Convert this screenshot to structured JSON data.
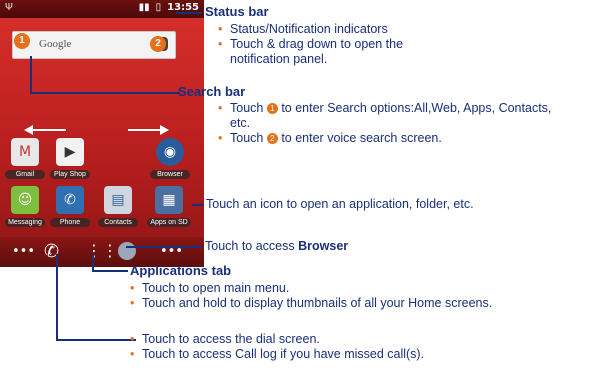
{
  "phone": {
    "status_time": "13:55",
    "search_placeholder": "Google",
    "badge1": "1",
    "badge2": "2",
    "apps": [
      {
        "label": "Gmail",
        "icon": "gmail-icon",
        "color": "#e8e8e8"
      },
      {
        "label": "Play Shop",
        "icon": "play-shop-icon",
        "color": "#f2f2f2"
      },
      {
        "label": "Browser",
        "icon": "browser-icon",
        "color": "#2a5b9a"
      },
      {
        "label": "Messaging",
        "icon": "messaging-icon",
        "color": "#7fbf3f"
      },
      {
        "label": "Phone",
        "icon": "phone-icon",
        "color": "#2f6fb2"
      },
      {
        "label": "Contacts",
        "icon": "contacts-icon",
        "color": "#cfd6e0"
      },
      {
        "label": "Apps on SD",
        "icon": "apps-on-sd-icon",
        "color": "#4a6fa0"
      }
    ],
    "dock": {
      "left": "•••",
      "right": "•••"
    }
  },
  "annotations": {
    "status_bar": {
      "title": "Status bar",
      "bullets": [
        "Status/Notification indicators",
        "Touch & drag down to open the notification panel."
      ]
    },
    "search_bar": {
      "title": "Search bar",
      "bullet1_pre": "Touch",
      "bullet1_post": "to enter Search options:All,Web, Apps, Contacts, etc.",
      "bullet2_pre": "Touch",
      "bullet2_post": "to enter voice search screen."
    },
    "icon_note": "Touch an icon to open an application, folder, etc.",
    "browser_note_pre": "Touch to access",
    "browser_note_bold": "Browser",
    "apps_tab": {
      "title": "Applications tab",
      "bullets": [
        "Touch to open main menu.",
        "Touch and hold to display thumbnails of all your Home screens."
      ]
    },
    "dial": {
      "bullets": [
        "Touch to access the dial screen.",
        "Touch to access Call log if you have missed call(s)."
      ]
    }
  },
  "colors": {
    "accent": "#e8701a",
    "text": "#1a2f7a",
    "wallpaper": "#c4261f"
  }
}
